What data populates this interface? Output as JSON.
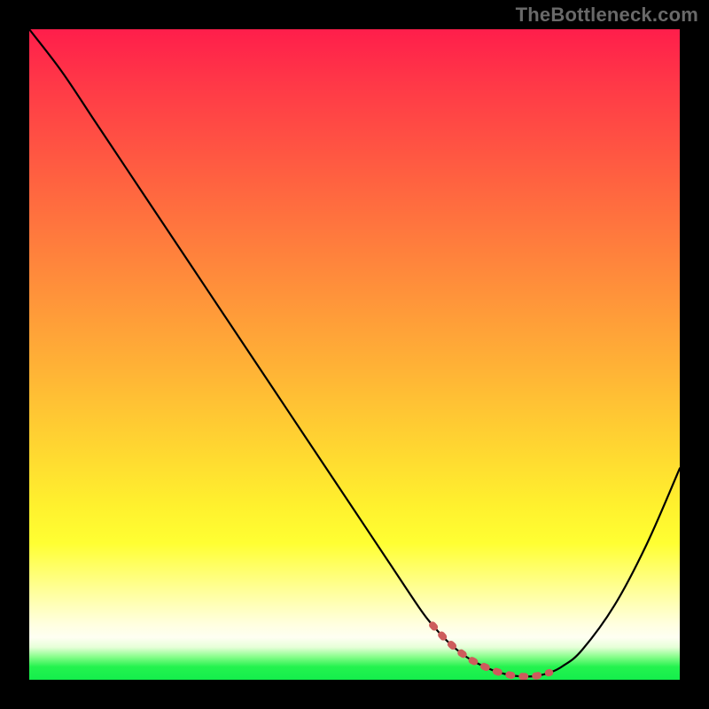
{
  "watermark": "TheBottleneck.com",
  "colors": {
    "gradient_top": "#ff1e4b",
    "gradient_mid": "#ffd531",
    "gradient_bottom": "#14ee4c",
    "curve": "#000000",
    "dots": "#cd5c5c",
    "frame": "#000000"
  },
  "chart_data": {
    "type": "line",
    "title": "",
    "xlabel": "",
    "ylabel": "",
    "xlim": [
      0,
      100
    ],
    "ylim": [
      0,
      100
    ],
    "series": [
      {
        "name": "curve",
        "x": [
          0,
          5,
          10,
          15,
          20,
          25,
          30,
          35,
          40,
          45,
          50,
          55,
          60,
          62,
          64,
          66,
          68,
          70,
          72,
          74,
          76,
          78,
          80,
          82,
          85,
          90,
          95,
          100
        ],
        "y": [
          100,
          93.5,
          86,
          78.5,
          71,
          63.5,
          56,
          48.5,
          41,
          33.5,
          26,
          18.5,
          11,
          8.4,
          6.2,
          4.4,
          3.0,
          2.0,
          1.2,
          0.7,
          0.5,
          0.6,
          1.1,
          2.1,
          4.6,
          11.5,
          21.0,
          32.5
        ]
      }
    ],
    "annotations": [
      {
        "name": "bottom-dots",
        "x_start": 62,
        "x_end": 80,
        "y": 0.8
      }
    ]
  }
}
